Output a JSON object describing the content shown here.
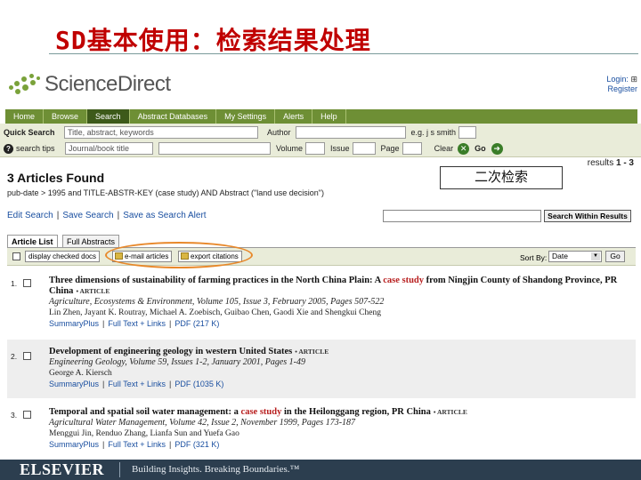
{
  "slide": {
    "title": "SD基本使用：检索结果处理",
    "callout": "二次检索"
  },
  "site": {
    "logo_text": "ScienceDirect",
    "login": "Login:",
    "register": "Register"
  },
  "nav": {
    "items": [
      {
        "label": "Home"
      },
      {
        "label": "Browse"
      },
      {
        "label": "Search",
        "active": true
      },
      {
        "label": "Abstract Databases"
      },
      {
        "label": "My Settings"
      },
      {
        "label": "Alerts"
      },
      {
        "label": "Help"
      }
    ]
  },
  "quick_search": {
    "label": "Quick Search",
    "field_terms_placeholder": "Title, abstract, keywords",
    "author_label": "Author",
    "author_example": "e.g. j s smith",
    "search_tips": "search tips",
    "journal_placeholder": "Journal/book title",
    "volume_label": "Volume",
    "issue_label": "Issue",
    "page_label": "Page",
    "clear_label": "Clear",
    "go_label": "Go"
  },
  "results": {
    "count_heading": "3 Articles Found",
    "range_prefix": "results",
    "range": "1 - 3",
    "query": "pub-date > 1995 and TITLE-ABSTR-KEY (case study) AND Abstract (\"land use decision\")",
    "links": [
      "Edit Search",
      "Save Search",
      "Save as Search Alert"
    ],
    "search_within_label": "Search Within Results"
  },
  "tabs": [
    {
      "label": "Article List",
      "active": true
    },
    {
      "label": "Full Abstracts"
    }
  ],
  "toolbar": {
    "display_checked": "display checked docs",
    "email_articles": "e-mail articles",
    "export_citations": "export citations",
    "sort_label": "Sort By:",
    "sort_value": "Date",
    "go_label": "Go"
  },
  "articles": [
    {
      "num": "1.",
      "title_before": "Three dimensions of sustainability of farming practices in the North China Plain: A ",
      "title_hl": "case study",
      "title_after": " from Ningjin County of Shandong Province, PR China",
      "type": "• ARTICLE",
      "journal": "Agriculture, Ecosystems & Environment, Volume 105, Issue 3, February 2005, Pages 507-522",
      "authors": "Lin Zhen, Jayant K. Routray, Michael A. Zoebisch, Guibao Chen, Gaodi Xie and Shengkui Cheng",
      "links": [
        "SummaryPlus",
        "Full Text + Links",
        "PDF (217 K)"
      ]
    },
    {
      "num": "2.",
      "title_before": "Development of engineering geology in western United States",
      "title_hl": "",
      "title_after": "",
      "type": "• ARTICLE",
      "journal": "Engineering Geology, Volume 59, Issues 1-2, January 2001, Pages 1-49",
      "authors": "George A. Kiersch",
      "links": [
        "SummaryPlus",
        "Full Text + Links",
        "PDF (1035 K)"
      ]
    },
    {
      "num": "3.",
      "title_before": "Temporal and spatial soil water management: a ",
      "title_hl": "case study",
      "title_after": " in the Heilonggang region, PR China",
      "type": "• ARTICLE",
      "journal": "Agricultural Water Management, Volume 42, Issue 2, November 1999, Pages 173-187",
      "authors": "Menggui Jin, Renduo Zhang, Lianfa Sun and Yuefa Gao",
      "links": [
        "SummaryPlus",
        "Full Text + Links",
        "PDF (321 K)"
      ]
    }
  ],
  "footer": {
    "brand": "ELSEVIER",
    "tagline": "Building Insights. Breaking Boundaries.™"
  },
  "colors": {
    "title_red": "#c00000",
    "nav_green": "#6e8f35",
    "highlight_orange": "#e8882a",
    "link_blue": "#1a4fa0",
    "footer_navy": "#2c3e4f"
  }
}
